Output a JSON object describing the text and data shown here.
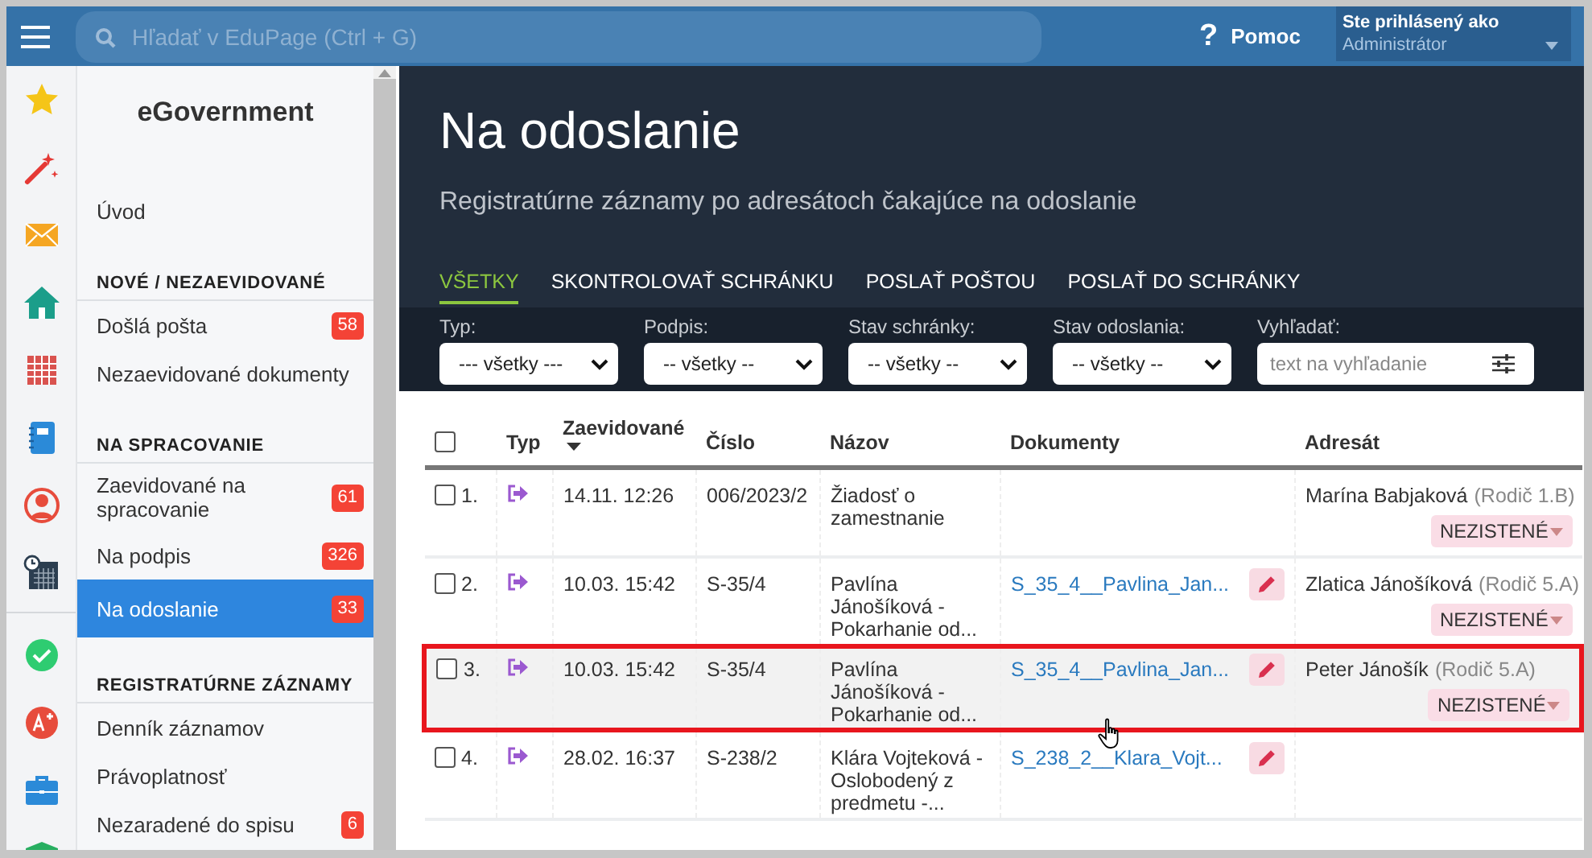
{
  "top_bar": {
    "search": {
      "placeholder": "Hľadať v EduPage (Ctrl + G)"
    },
    "help": {
      "icon": "?",
      "label": "Pomoc"
    },
    "user": {
      "caption": "Ste prihlásený ako",
      "name": "Administrátor"
    }
  },
  "sidebar": {
    "title": "eGovernment",
    "items": [
      {
        "kind": "item",
        "label": "Úvod",
        "selected": false
      },
      {
        "kind": "heading",
        "label": "NOVÉ / NEZAEVIDOVANÉ"
      },
      {
        "kind": "item",
        "label": "Došlá pošta",
        "badge": "58",
        "selected": false
      },
      {
        "kind": "item",
        "label": "Nezaevidované dokumenty",
        "selected": false
      },
      {
        "kind": "heading",
        "label": "NA SPRACOVANIE"
      },
      {
        "kind": "item",
        "label": "Zaevidované na spracovanie",
        "badge": "61",
        "selected": false
      },
      {
        "kind": "item",
        "label": "Na podpis",
        "badge": "326",
        "selected": false
      },
      {
        "kind": "item",
        "label": "Na odoslanie",
        "badge": "33",
        "selected": true
      },
      {
        "kind": "heading",
        "label": "REGISTRATÚRNE ZÁZNAMY"
      },
      {
        "kind": "item",
        "label": "Denník záznamov",
        "selected": false
      },
      {
        "kind": "item",
        "label": "Právoplatnosť",
        "selected": false
      },
      {
        "kind": "item",
        "label": "Nezaradené do spisu",
        "badge": "6",
        "selected": false
      }
    ]
  },
  "page": {
    "title": "Na odoslanie",
    "subtitle": "Registratúrne záznamy po adresátoch čakajúce na odoslanie"
  },
  "tabs": [
    {
      "label": "VŠETKY",
      "selected": true
    },
    {
      "label": "SKONTROLOVAŤ SCHRÁNKU",
      "selected": false
    },
    {
      "label": "POSLAŤ POŠTOU",
      "selected": false
    },
    {
      "label": "POSLAŤ DO SCHRÁNKY",
      "selected": false
    }
  ],
  "filters": [
    {
      "kind": "select",
      "label": "Typ:",
      "value": "--- všetky ---"
    },
    {
      "kind": "select",
      "label": "Podpis:",
      "value": "-- všetky --"
    },
    {
      "kind": "select",
      "label": "Stav schránky:",
      "value": "-- všetky --"
    },
    {
      "kind": "select",
      "label": "Stav odoslania:",
      "value": "-- všetky --"
    },
    {
      "kind": "search",
      "label": "Vyhľadať:",
      "placeholder": "text na vyhľadanie"
    }
  ],
  "table": {
    "select_all_checked": false,
    "columns": [
      {
        "label": "Typ",
        "sorted": false
      },
      {
        "label": "Zaevidované",
        "sorted": true
      },
      {
        "label": "Číslo",
        "sorted": false
      },
      {
        "label": "Názov",
        "sorted": false
      },
      {
        "label": "Dokumenty",
        "sorted": false
      },
      {
        "label": "Adresát",
        "sorted": false
      }
    ],
    "rows": [
      {
        "number": "1.",
        "checked": false,
        "highlighted": false,
        "date": "14.11. 12:26",
        "ref": "006/2023/2",
        "title": "Žiadosť o zamestnanie",
        "recipient": "Marína Babjaková",
        "recipient_role": "(Rodič 1.B)",
        "status": "NEZISTENÉ"
      },
      {
        "number": "2.",
        "checked": false,
        "highlighted": false,
        "date": "10.03. 15:42",
        "ref": "S-35/4",
        "title": "Pavlína Jánošíková - Pokarhanie od...",
        "document": "S_35_4__Pavlina_Jan...",
        "recipient": "Zlatica Jánošíková",
        "recipient_role": "(Rodič 5.A)",
        "status": "NEZISTENÉ"
      },
      {
        "number": "3.",
        "checked": false,
        "highlighted": true,
        "date": "10.03. 15:42",
        "ref": "S-35/4",
        "title": "Pavlína Jánošíková - Pokarhanie od...",
        "document": "S_35_4__Pavlina_Jan...",
        "recipient": "Peter Jánošík",
        "recipient_role": "(Rodič 5.A)",
        "status": "NEZISTENÉ"
      },
      {
        "number": "4.",
        "checked": false,
        "highlighted": false,
        "date": "28.02. 16:37",
        "ref": "S-238/2",
        "title": "Klára Vojteková - Oslobodený z predmetu -...",
        "document": "S_238_2__Klara_Vojt..."
      }
    ]
  }
}
